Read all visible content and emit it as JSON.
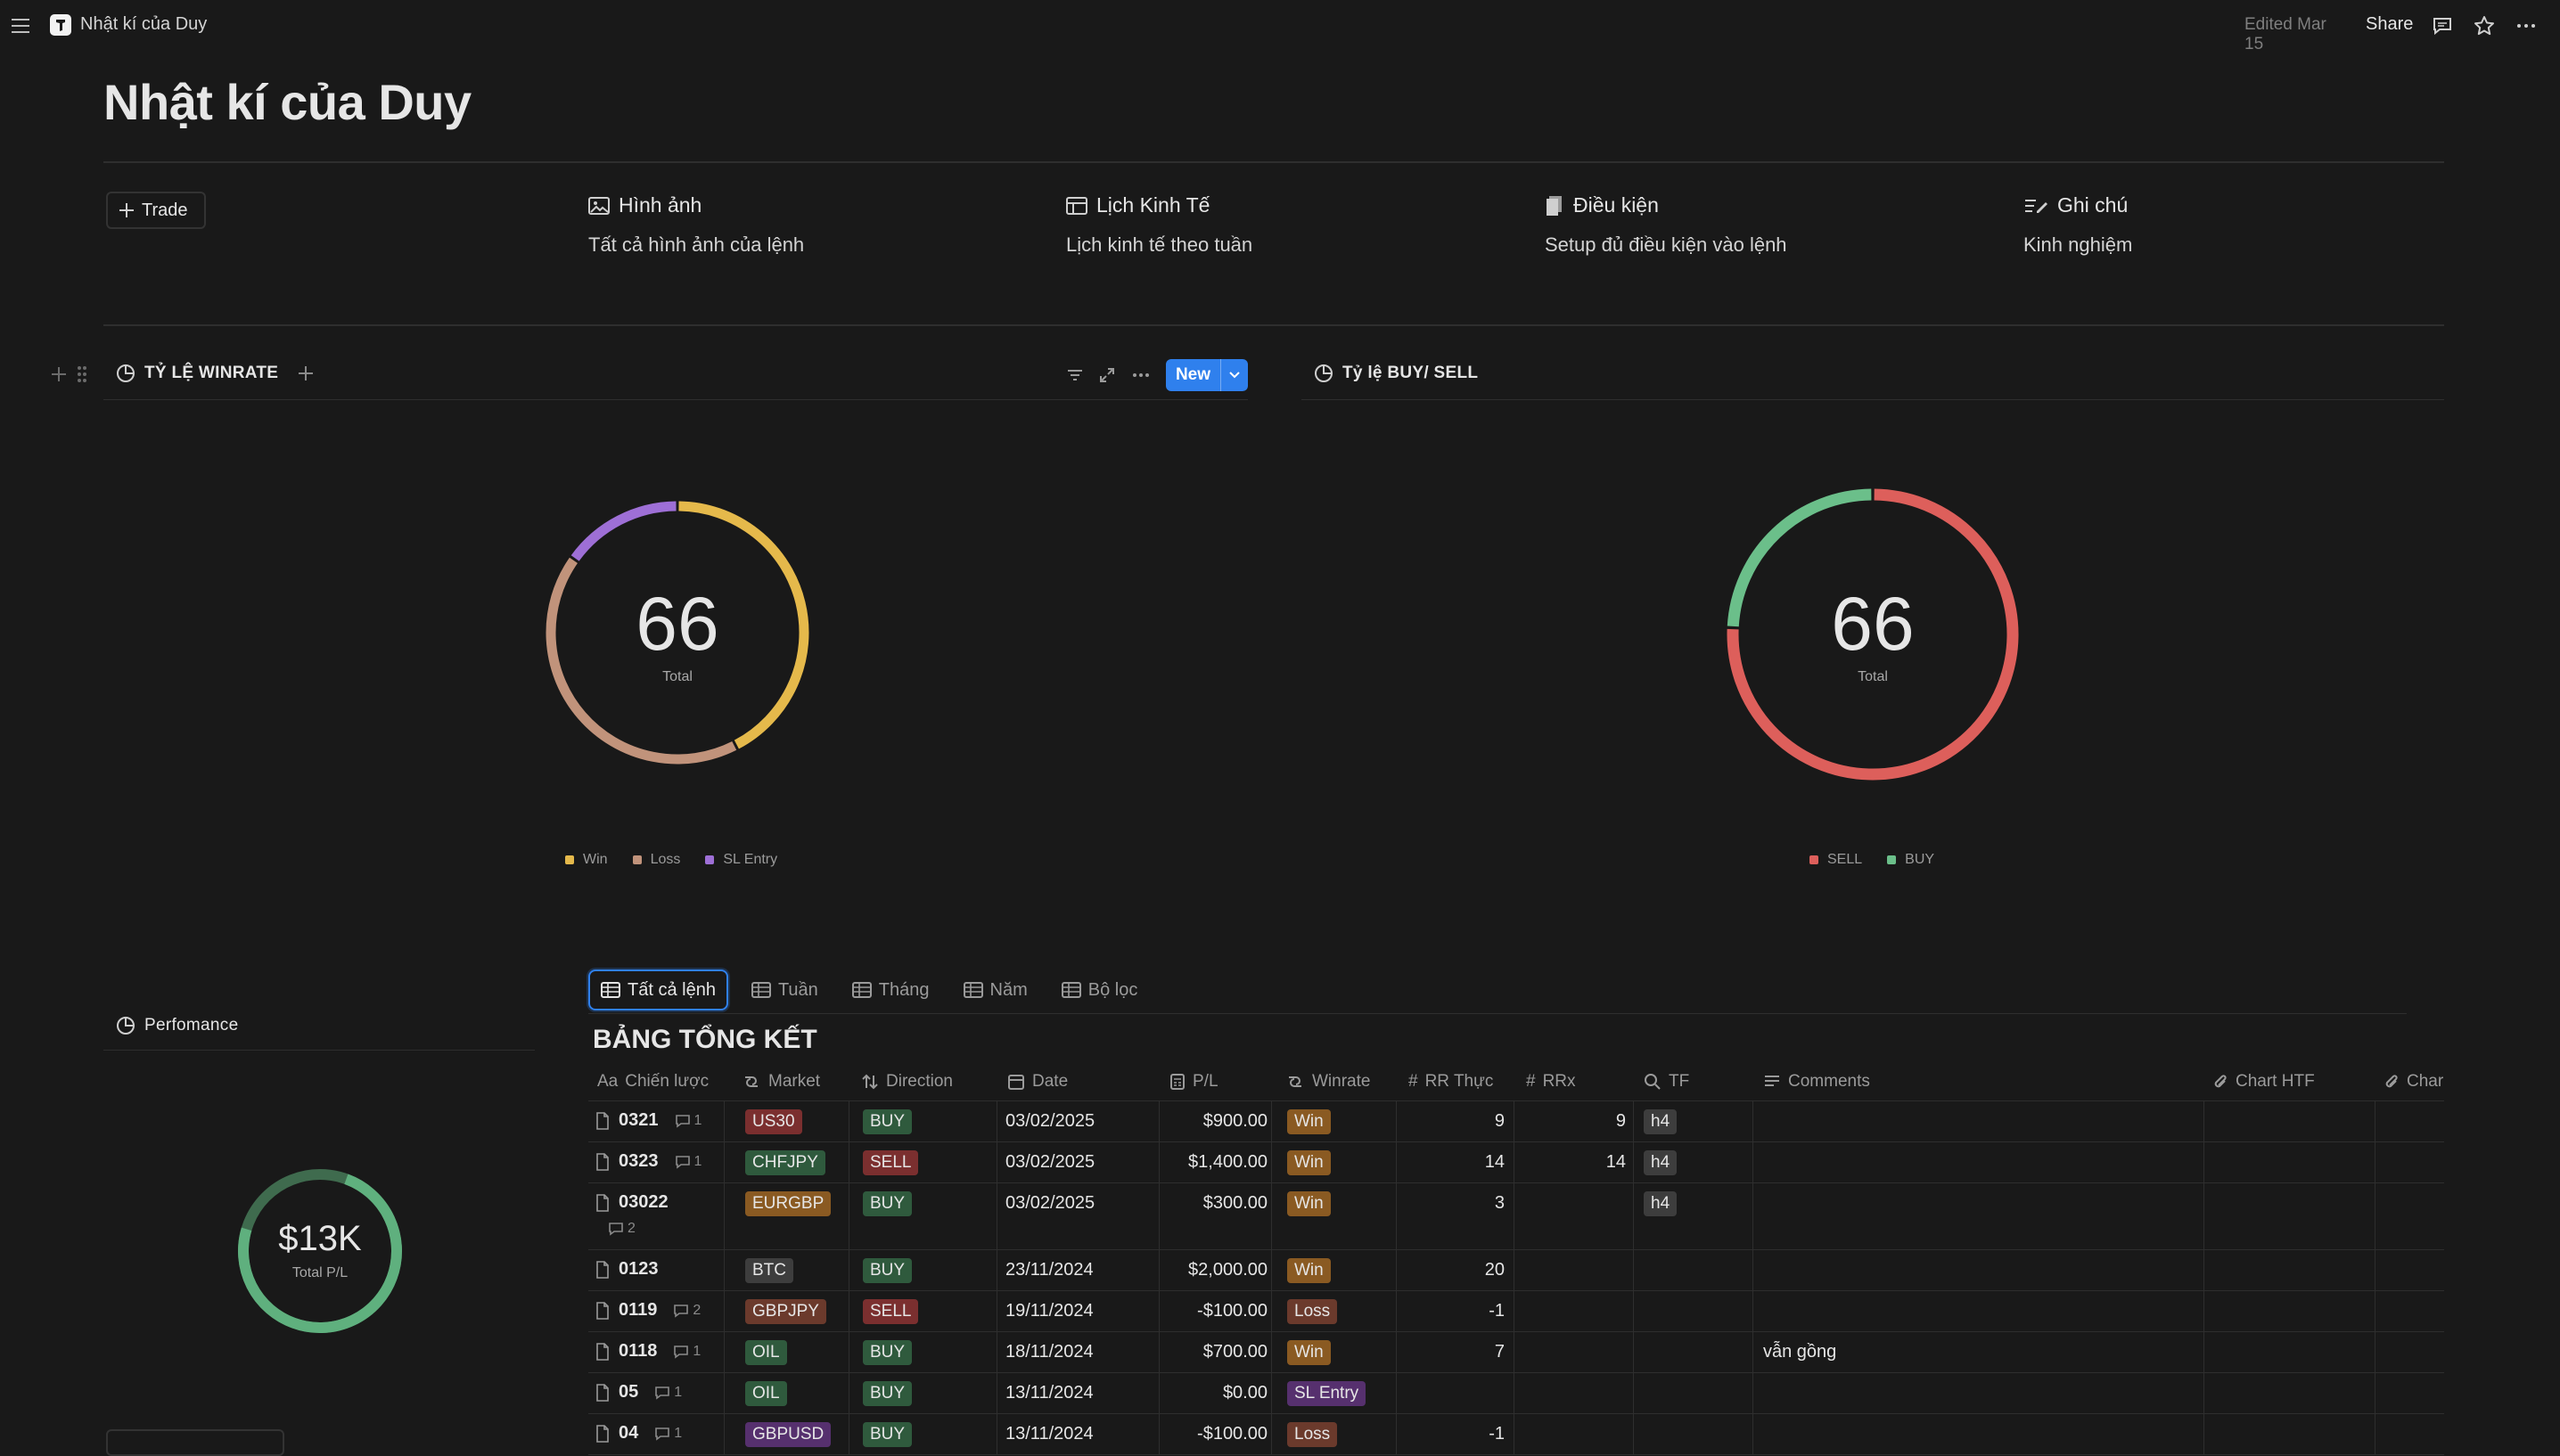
{
  "topbar": {
    "page_name": "Nhật kí của Duy",
    "edited": "Edited Mar 15",
    "share": "Share"
  },
  "page": {
    "title": "Nhật kí của Duy"
  },
  "actions": {
    "trade_label": "Trade"
  },
  "callouts": [
    {
      "title": "Hình ảnh",
      "desc": "Tất cả hình ảnh của lệnh",
      "icon": "image-icon"
    },
    {
      "title": "Lịch Kinh Tế",
      "desc": "Lịch kinh tế theo tuần",
      "icon": "calendar-icon"
    },
    {
      "title": "Điều kiện",
      "desc": "Setup đủ điều kiện vào lệnh",
      "icon": "document-icon"
    },
    {
      "title": "Ghi chú",
      "desc": "Kinh nghiệm",
      "icon": "note-icon"
    }
  ],
  "winrate": {
    "label": "TỶ LỆ WINRATE",
    "new_label": "New",
    "chart": {
      "type": "pie",
      "total": "66",
      "total_label": "Total",
      "series": [
        {
          "name": "Win",
          "value": 28,
          "color": "#e5b94b"
        },
        {
          "name": "Loss",
          "value": 28,
          "color": "#c1937b"
        },
        {
          "name": "SL Entry",
          "value": 10,
          "color": "#9e6fd6"
        }
      ]
    }
  },
  "buysell": {
    "label": "Tỷ lệ BUY/ SELL",
    "chart": {
      "type": "pie",
      "total": "66",
      "total_label": "Total",
      "series": [
        {
          "name": "SELL",
          "value": 50,
          "color": "#dd5f5b"
        },
        {
          "name": "BUY",
          "value": 16,
          "color": "#6bbf8a"
        }
      ]
    }
  },
  "performance": {
    "label": "Perfomance",
    "value": "$13K",
    "sub": "Total P/L",
    "color": "#5fb07e"
  },
  "tabs": [
    {
      "label": "Tất cả lệnh",
      "active": true
    },
    {
      "label": "Tuần",
      "active": false
    },
    {
      "label": "Tháng",
      "active": false
    },
    {
      "label": "Năm",
      "active": false
    },
    {
      "label": "Bộ lọc",
      "active": false
    }
  ],
  "table": {
    "title": "BẢNG TỔNG KẾT",
    "columns": [
      "Chiến lược",
      "Market",
      "Direction",
      "Date",
      "P/L",
      "Winrate",
      "RR Thực",
      "RRx",
      "TF",
      "Comments",
      "Chart HTF",
      "Char"
    ],
    "column_prefix": "Aa",
    "rows": [
      {
        "name": "0321",
        "comments": "1",
        "market": "US30",
        "market_color": "#7b2f2f",
        "direction": "BUY",
        "date": "03/02/2025",
        "pl": "$900.00",
        "winrate": "Win",
        "rr": "9",
        "rrx": "9",
        "tf": "h4",
        "note": ""
      },
      {
        "name": "0323",
        "comments": "1",
        "market": "CHFJPY",
        "market_color": "#2f5a3d",
        "direction": "SELL",
        "date": "03/02/2025",
        "pl": "$1,400.00",
        "winrate": "Win",
        "rr": "14",
        "rrx": "14",
        "tf": "h4",
        "note": ""
      },
      {
        "name": "03022",
        "comments": "2",
        "market": "EURGBP",
        "market_color": "#8a5a22",
        "direction": "BUY",
        "date": "03/02/2025",
        "pl": "$300.00",
        "winrate": "Win",
        "rr": "3",
        "rrx": "",
        "tf": "h4",
        "note": ""
      },
      {
        "name": "0123",
        "comments": "",
        "market": "BTC",
        "market_color": "#3d3d3d",
        "direction": "BUY",
        "date": "23/11/2024",
        "pl": "$2,000.00",
        "winrate": "Win",
        "rr": "20",
        "rrx": "",
        "tf": "",
        "note": ""
      },
      {
        "name": "0119",
        "comments": "2",
        "market": "GBPJPY",
        "market_color": "#6b3a2c",
        "direction": "SELL",
        "date": "19/11/2024",
        "pl": "-$100.00",
        "winrate": "Loss",
        "rr": "-1",
        "rrx": "",
        "tf": "",
        "note": ""
      },
      {
        "name": "0118",
        "comments": "1",
        "market": "OIL",
        "market_color": "#2f5a3d",
        "direction": "BUY",
        "date": "18/11/2024",
        "pl": "$700.00",
        "winrate": "Win",
        "rr": "7",
        "rrx": "",
        "tf": "",
        "note": "vẫn gồng"
      },
      {
        "name": "05",
        "comments": "1",
        "market": "OIL",
        "market_color": "#2f5a3d",
        "direction": "BUY",
        "date": "13/11/2024",
        "pl": "$0.00",
        "winrate": "SL Entry",
        "rr": "",
        "rrx": "",
        "tf": "",
        "note": ""
      },
      {
        "name": "04",
        "comments": "1",
        "market": "GBPUSD",
        "market_color": "#56306e",
        "direction": "BUY",
        "date": "13/11/2024",
        "pl": "-$100.00",
        "winrate": "Loss",
        "rr": "-1",
        "rrx": "",
        "tf": "",
        "note": ""
      }
    ]
  },
  "colors": {
    "buy": "#2f5a3d",
    "sell": "#7b2f2f",
    "win": "#8a5a22",
    "loss": "#6b3a2c",
    "sl_entry": "#56306e",
    "tf": "#3d3d3d"
  }
}
